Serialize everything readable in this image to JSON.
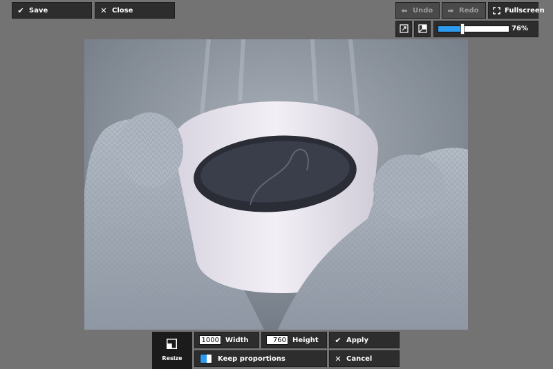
{
  "top_left": {
    "save_label": "Save",
    "close_label": "Close"
  },
  "top_right": {
    "undo_label": "Undo",
    "redo_label": "Redo",
    "fullscreen_label": "Fullscreen"
  },
  "zoom": {
    "value_label": "76%",
    "level_fraction": 0.76
  },
  "bottom_toolbar": {
    "resize_label": "Resize",
    "width_value": "1000",
    "width_label": "Width",
    "height_value": "760",
    "height_label": "Height",
    "keep_proportions_label": "Keep proportions",
    "keep_proportions_checked": true,
    "apply_label": "Apply",
    "cancel_label": "Cancel"
  },
  "colors": {
    "background": "#737373",
    "button": "#2d2d2d",
    "accent": "#2e9bef"
  }
}
